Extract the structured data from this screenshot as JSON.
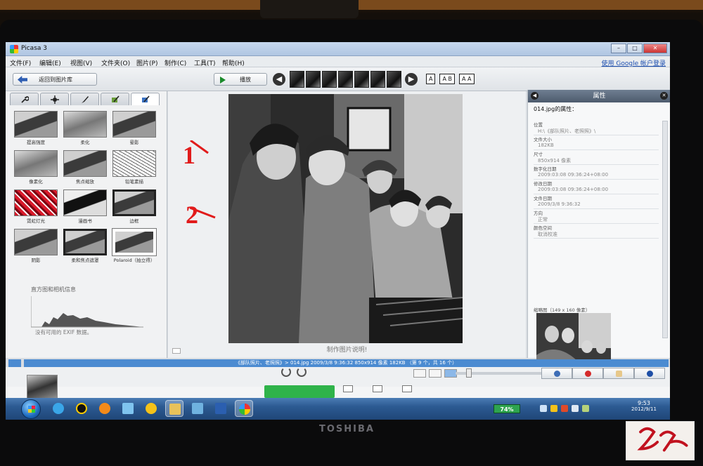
{
  "window": {
    "title": "Picasa 3",
    "controls": [
      "–",
      "□",
      "✕"
    ]
  },
  "menu": {
    "items": [
      "文件(F)",
      "编辑(E)",
      "视图(V)",
      "文件夹(O)",
      "图片(P)",
      "制作(C)",
      "工具(T)",
      "帮助(H)"
    ],
    "account_link": "使用 Google 帐户登录"
  },
  "toolbar": {
    "back_label": "返回到图片库",
    "play_label": "播放",
    "caption_modes": [
      "A",
      "A B",
      "A A"
    ]
  },
  "edit_panel": {
    "tabs": [
      "wrench-icon",
      "tune-icon",
      "brush-icon",
      "effects-icon",
      "creative-icon"
    ],
    "active_tab": 4,
    "effects": [
      {
        "label": "提高强度",
        "style": "photo"
      },
      {
        "label": "柔化",
        "style": "soft"
      },
      {
        "label": "晕影",
        "style": "photo"
      },
      {
        "label": "像素化",
        "style": "soft"
      },
      {
        "label": "焦点缩放",
        "style": "photo"
      },
      {
        "label": "铅笔素描",
        "style": "sketch"
      },
      {
        "label": "霓虹灯光",
        "style": "red"
      },
      {
        "label": "漫画书",
        "style": "comic"
      },
      {
        "label": "边框",
        "style": "framed"
      },
      {
        "label": "阴影",
        "style": "photo"
      },
      {
        "label": "柔和焦点遮罩",
        "style": "framed"
      },
      {
        "label": "Polaroid（拍立得）",
        "style": "polaroid"
      }
    ],
    "histogram_title": "直方图和相机信息",
    "exif_note": "没有可用的 EXIF 数据。"
  },
  "annotations": {
    "one": "1",
    "two": "2",
    "color": "#e11b1b"
  },
  "viewer": {
    "caption_prompt": "制作图片说明!"
  },
  "properties": {
    "header": "属性",
    "file_title": "014.jpg的属性：",
    "rows": [
      {
        "key": "位置",
        "value": "H:\\《部队照片、老照照》\\"
      },
      {
        "key": "文件大小",
        "value": "182KB"
      },
      {
        "key": "尺寸",
        "value": "850x914 像素"
      },
      {
        "key": "数字化日期",
        "value": "2009:03:08 09:36:24+08:00"
      },
      {
        "key": "修改日期",
        "value": "2009:03:08 09:36:24+08:00"
      },
      {
        "key": "文件日期",
        "value": "2009/3/8 9:36:32"
      },
      {
        "key": "方向",
        "value": "正常"
      },
      {
        "key": "颜色空间",
        "value": "取消校准"
      }
    ],
    "thumb_label": "缩略图（149 x 160 像素）"
  },
  "status": {
    "info_line": "《部队照片、老照照》> 014.jpg     2009/3/8 9:36:32     850x914 像素     182KB     （第 9 个，共 16 个）"
  },
  "taskbar": {
    "battery": "74%",
    "time": "9:53",
    "date": "2012/9/11",
    "brand": "TOSHIBA"
  },
  "colors": {
    "accent_blue": "#4b8bd1",
    "upload_green": "#2fb34a",
    "taskbar": "#2c5a92"
  }
}
